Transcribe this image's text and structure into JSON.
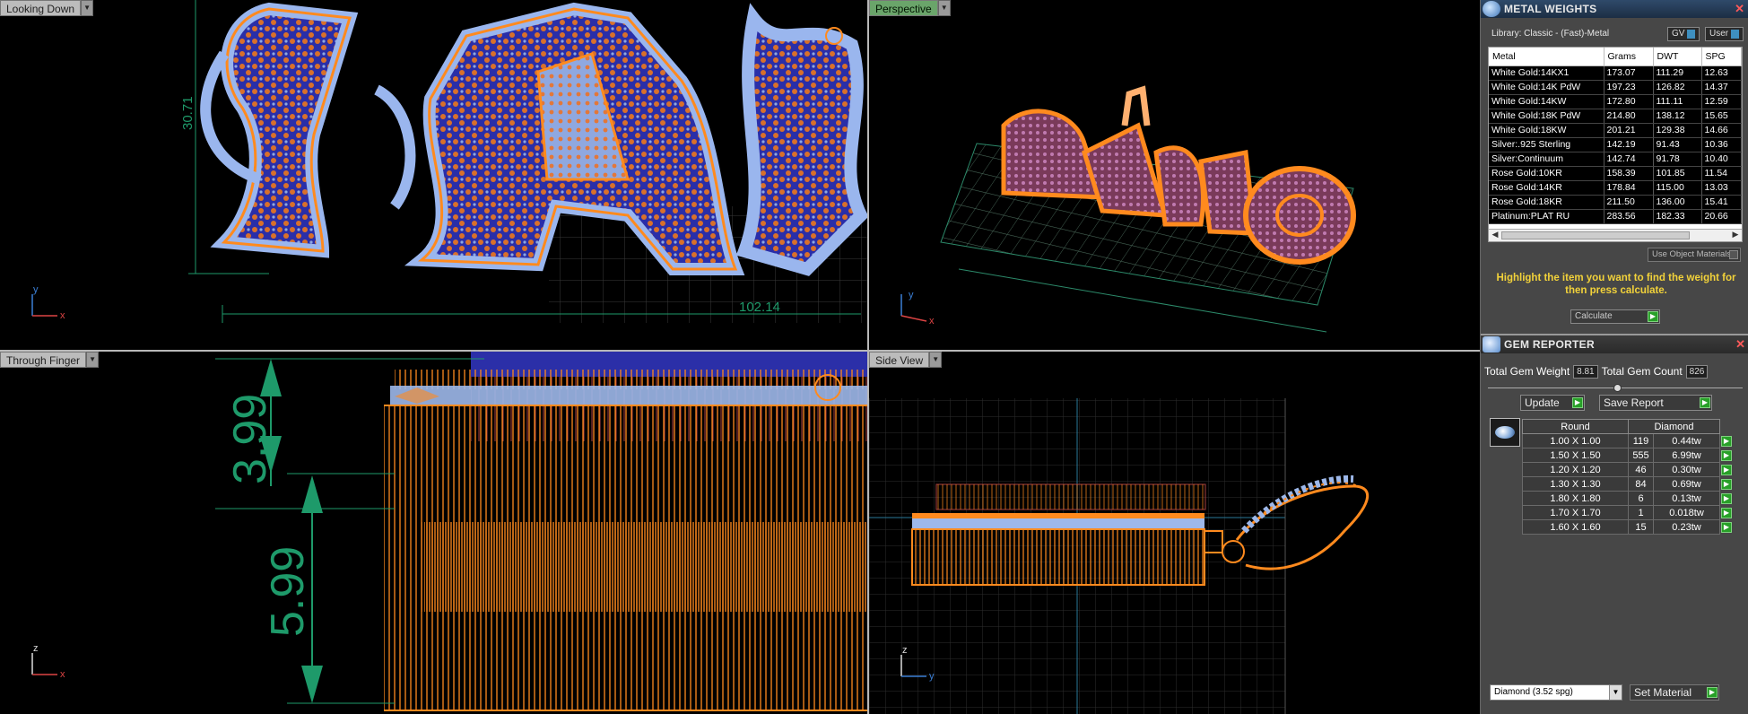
{
  "viewports": {
    "top_left": {
      "label": "Looking Down",
      "dim_vertical": "30.71",
      "dim_horizontal": "102.14",
      "axis_v": "y",
      "axis_h": "x"
    },
    "top_right": {
      "label": "Perspective",
      "axis_v": "y",
      "axis_h": "x"
    },
    "bottom_left": {
      "label": "Through Finger",
      "dim_top": "3.99",
      "dim_bottom": "5.99",
      "axis_v": "z",
      "axis_h": "x"
    },
    "bottom_right": {
      "label": "Side View",
      "axis_v": "z",
      "axis_h": "y"
    }
  },
  "metal_weights": {
    "title": "METAL WEIGHTS",
    "library": "Library: Classic - (Fast)-Metal",
    "gv_label": "GV",
    "user_label": "User",
    "columns": [
      "Metal",
      "Grams",
      "DWT",
      "SPG"
    ],
    "rows": [
      [
        "White Gold:14KX1",
        "173.07",
        "111.29",
        "12.63"
      ],
      [
        "White Gold:14K PdW",
        "197.23",
        "126.82",
        "14.37"
      ],
      [
        "White Gold:14KW",
        "172.80",
        "111.11",
        "12.59"
      ],
      [
        "White Gold:18K PdW",
        "214.80",
        "138.12",
        "15.65"
      ],
      [
        "White Gold:18KW",
        "201.21",
        "129.38",
        "14.66"
      ],
      [
        "Silver:.925 Sterling",
        "142.19",
        "91.43",
        "10.36"
      ],
      [
        "Silver:Continuum",
        "142.74",
        "91.78",
        "10.40"
      ],
      [
        "Rose Gold:10KR",
        "158.39",
        "101.85",
        "11.54"
      ],
      [
        "Rose Gold:14KR",
        "178.84",
        "115.00",
        "13.03"
      ],
      [
        "Rose Gold:18KR",
        "211.50",
        "136.00",
        "15.41"
      ],
      [
        "Platinum:PLAT RU",
        "283.56",
        "182.33",
        "20.66"
      ]
    ],
    "use_object_materials": "Use Object Materials",
    "hint": "Highlight the item you want to find the weight for then press calculate.",
    "calculate": "Calculate"
  },
  "gem_reporter": {
    "title": "GEM REPORTER",
    "total_weight_label": "Total Gem Weight",
    "total_weight": "8.81",
    "total_count_label": "Total Gem Count",
    "total_count": "826",
    "update": "Update",
    "save_report": "Save Report",
    "col_shape": "Round",
    "col_material": "Diamond",
    "rows": [
      [
        "1.00 X 1.00",
        "119",
        "0.44tw"
      ],
      [
        "1.50 X 1.50",
        "555",
        "6.99tw"
      ],
      [
        "1.20 X 1.20",
        "46",
        "0.30tw"
      ],
      [
        "1.30 X 1.30",
        "84",
        "0.69tw"
      ],
      [
        "1.80 X 1.80",
        "6",
        "0.13tw"
      ],
      [
        "1.70 X 1.70",
        "1",
        "0.018tw"
      ],
      [
        "1.60 X 1.60",
        "15",
        "0.23tw"
      ]
    ],
    "material_select": "Diamond    (3.52 spg)",
    "set_material": "Set Material"
  },
  "colors": {
    "metal_orange": "#ff8a1e",
    "gem_blue": "#9db8ea",
    "pave_blue": "#2b2fa8",
    "grid_green": "#2c8a6a",
    "dim_green": "#1e9a6a",
    "hint_yellow": "#f2d23a"
  }
}
